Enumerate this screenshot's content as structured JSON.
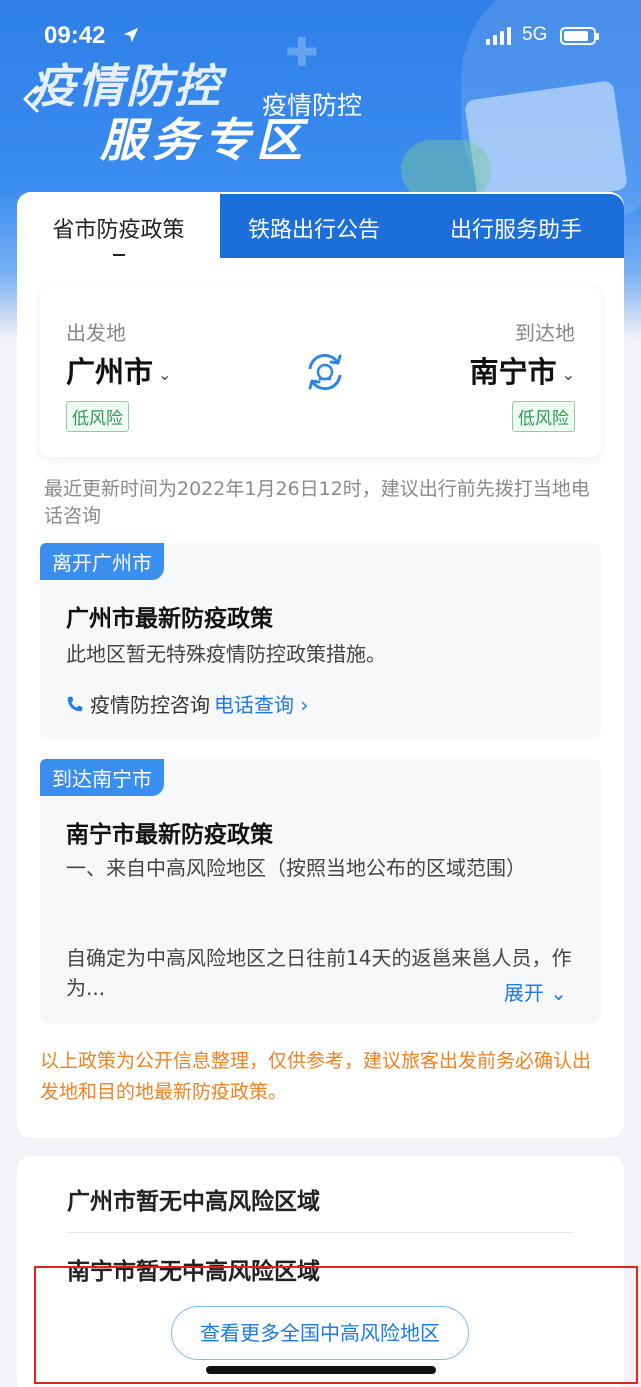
{
  "status_bar": {
    "time": "09:42",
    "network": "5G"
  },
  "header": {
    "title_art_line1": "疫情防控",
    "title_art_line2": "服务专区",
    "page_title": "疫情防控"
  },
  "tabs": [
    {
      "label": "省市防疫政策",
      "active": true
    },
    {
      "label": "铁路出行公告",
      "active": false
    },
    {
      "label": "出行服务助手",
      "active": false
    }
  ],
  "route": {
    "from_label": "出发地",
    "from_city": "广州市",
    "from_risk": "低风险",
    "to_label": "到达地",
    "to_city": "南宁市",
    "to_risk": "低风险"
  },
  "update_notice": "最近更新时间为2022年1月26日12时，建议出行前先拨打当地电话咨询",
  "leave_section": {
    "tag": "离开广州市",
    "title": "广州市最新防疫政策",
    "body": "此地区暂无特殊疫情防控政策措施。",
    "consult_label": "疫情防控咨询",
    "consult_link": "电话查询",
    "link_chevron": "›"
  },
  "arrive_section": {
    "tag": "到达南宁市",
    "title": "南宁市最新防疫政策",
    "body1": "一、来自中高风险地区（按照当地公布的区域范围）",
    "body2": "自确定为中高风险地区之日往前14天的返邕来邕人员，作为...",
    "expand_label": "展开",
    "expand_chevron": "⌄"
  },
  "disclaimer": "以上政策为公开信息整理，仅供参考，建议旅客出发前务必确认出发地和目的地最新防疫政策。",
  "risk_areas": {
    "line1": "广州市暂无中高风险区域",
    "line2": "南宁市暂无中高风险区域",
    "more_button": "查看更多全国中高风险地区"
  },
  "chevron_down": "⌄",
  "colors": {
    "accent": "#1f79e8",
    "tab_bar": "#1c6fd8",
    "low_risk": "#2e9b55",
    "warning": "#f2821f",
    "highlight_box": "#e2231a"
  },
  "icons": [
    "location-arrow-icon",
    "signal-icon",
    "battery-icon",
    "back-icon",
    "swap-station-icon",
    "phone-icon",
    "chevron-down-icon",
    "chevron-right-icon"
  ]
}
